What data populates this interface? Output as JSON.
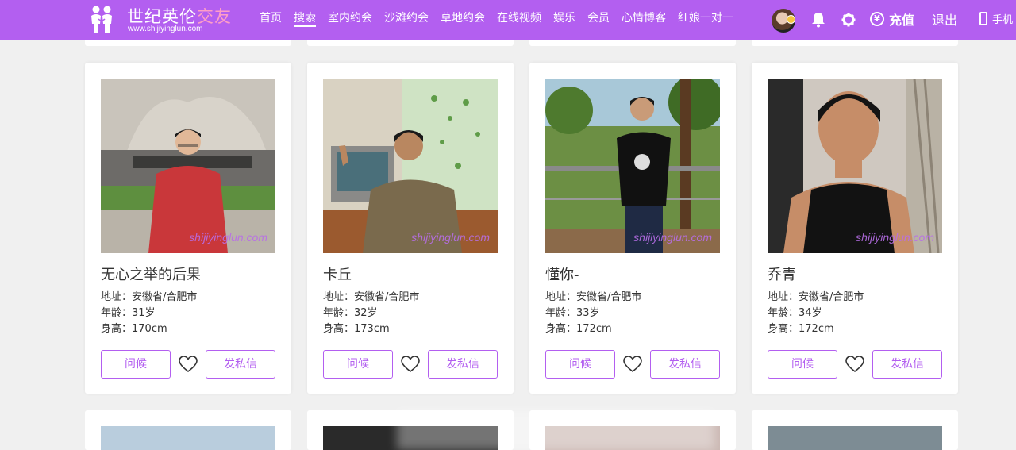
{
  "header": {
    "logo": {
      "title_main": "世纪英伦",
      "title_accent": "交友",
      "url": "www.shijiyinglun.com"
    },
    "nav": [
      {
        "label": "首页",
        "active": false
      },
      {
        "label": "搜索",
        "active": true
      },
      {
        "label": "室内约会",
        "active": false
      },
      {
        "label": "沙滩约会",
        "active": false
      },
      {
        "label": "草地约会",
        "active": false
      },
      {
        "label": "在线视频",
        "active": false
      },
      {
        "label": "娱乐",
        "active": false
      },
      {
        "label": "会员",
        "active": false
      },
      {
        "label": "心情博客",
        "active": false
      },
      {
        "label": "红娘一对一",
        "active": false
      }
    ],
    "recharge": "充值",
    "logout": "退出",
    "mobile": "手机",
    "icons": [
      "avatar",
      "bell-icon",
      "gear-icon",
      "yen-icon",
      "phone-icon"
    ]
  },
  "profiles": [
    {
      "name": "无心之举的后果",
      "address": "地址：安徽省/合肥市",
      "age": "年龄：31岁",
      "height": "身高：170cm",
      "watermark": "shijiyinglun.com",
      "greet": "问候",
      "message": "发私信"
    },
    {
      "name": "卡丘",
      "address": "地址：安徽省/合肥市",
      "age": "年龄：32岁",
      "height": "身高：173cm",
      "watermark": "shijiyinglun.com",
      "greet": "问候",
      "message": "发私信"
    },
    {
      "name": "懂你-",
      "address": "地址：安徽省/合肥市",
      "age": "年龄：33岁",
      "height": "身高：172cm",
      "watermark": "shijiyinglun.com",
      "greet": "问候",
      "message": "发私信"
    },
    {
      "name": "乔青",
      "address": "地址：安徽省/合肥市",
      "age": "年龄：34岁",
      "height": "身高：172cm",
      "watermark": "shijiyinglun.com",
      "greet": "问候",
      "message": "发私信"
    }
  ],
  "colors": {
    "brand": "#b35ff0",
    "watermark": "#b86ee8",
    "background": "#f0f0f0"
  }
}
